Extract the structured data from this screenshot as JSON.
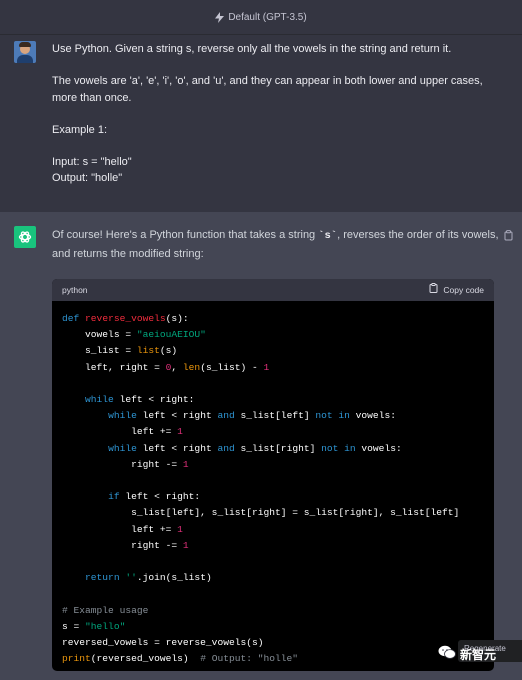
{
  "header": {
    "model_label": "Default (GPT-3.5)"
  },
  "user_message": {
    "paragraphs": [
      "Use Python. Given a string s, reverse only all the vowels in the string and return it.",
      "The vowels are 'a', 'e', 'i', 'o', and 'u', and they can appear in both lower and upper cases, more than once.",
      "Example 1:",
      "Input: s = \"hello\"\nOutput: \"holle\""
    ]
  },
  "assistant_message": {
    "intro_before": "Of course! Here's a Python function that takes a string ",
    "intro_code": "`s`",
    "intro_after": ", reverses the order of its vowels, and returns the modified string:",
    "code_language": "python",
    "copy_label": "Copy code"
  },
  "overlay": {
    "tooltip_text": "Regenerate",
    "watermark_text": "新智元"
  },
  "colors": {
    "background": "#343541",
    "assistant_background": "#444654",
    "accent_green": "#19c37d"
  }
}
